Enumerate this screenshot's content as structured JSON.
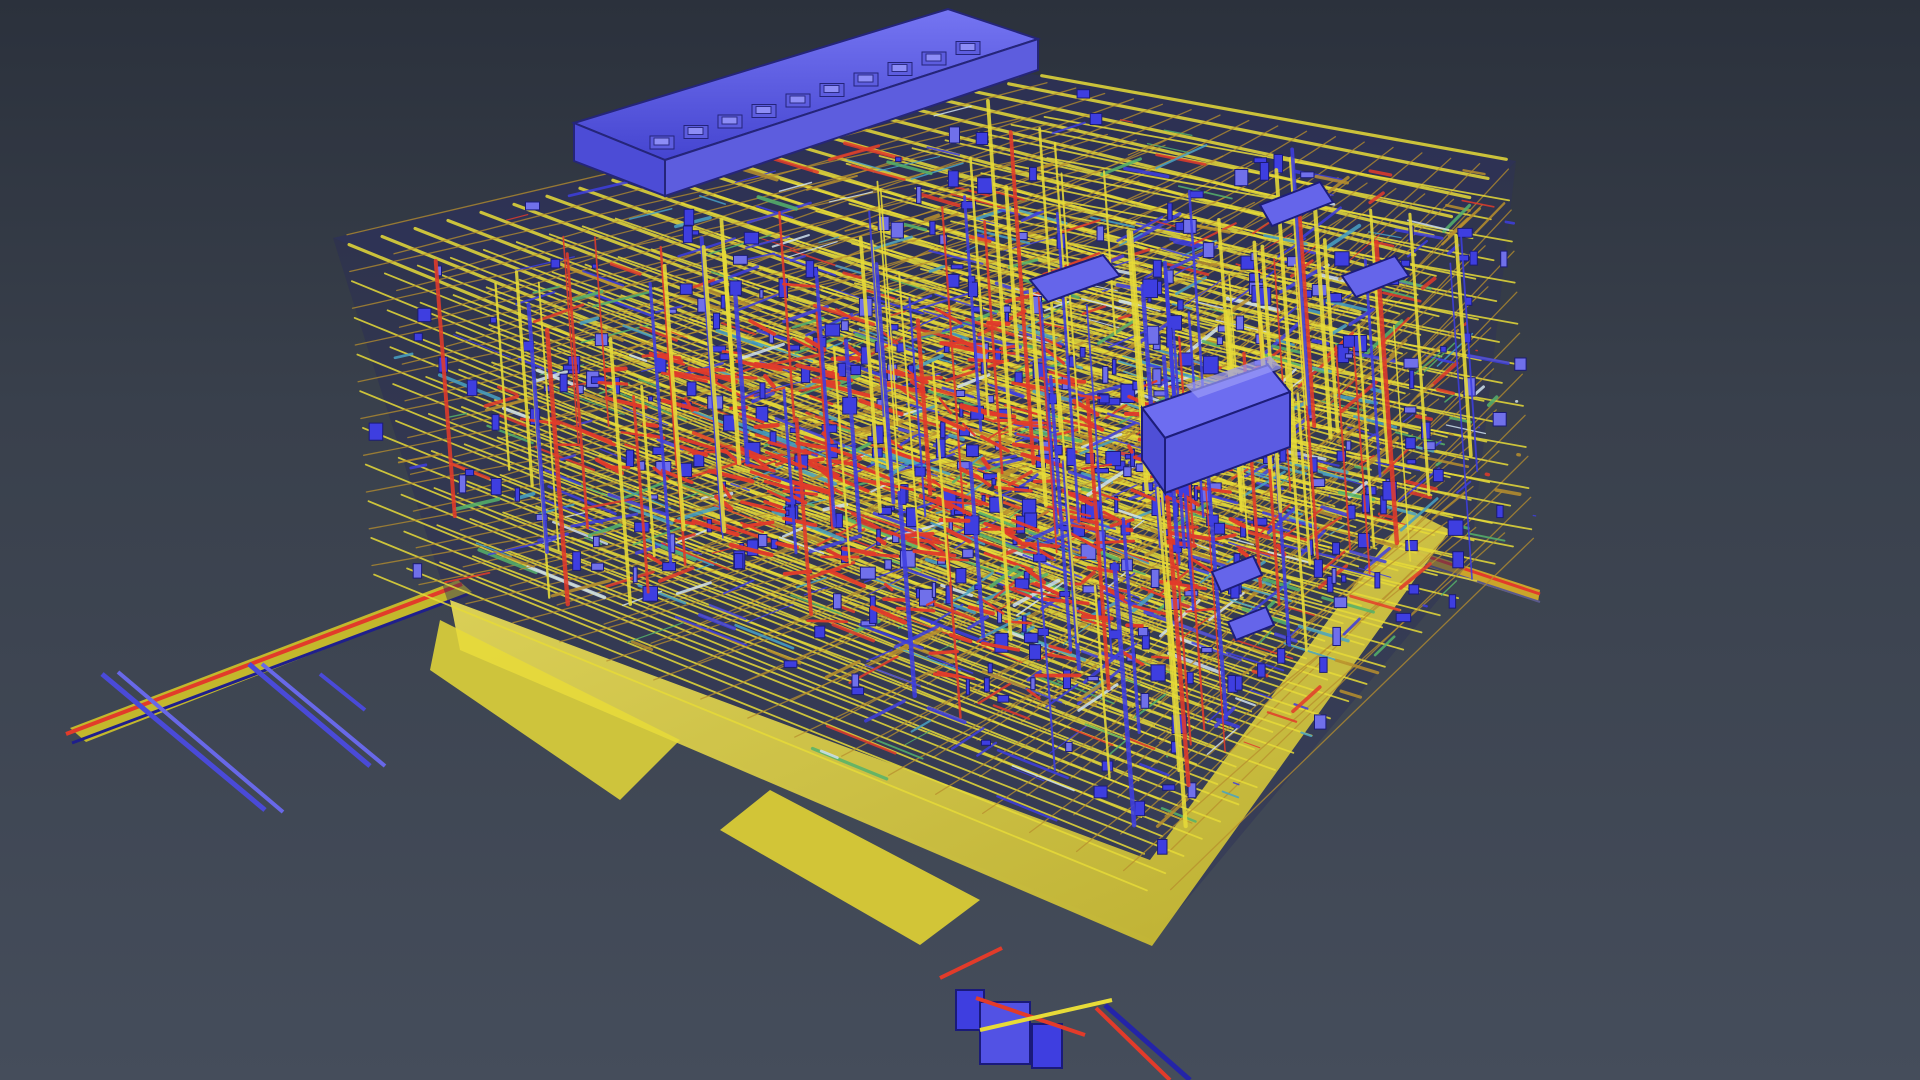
{
  "viewer": {
    "background_top": "#2b313c",
    "background_bottom": "#454d5b"
  },
  "model": {
    "layer_colors": {
      "structure": "#e7db38",
      "piping_hot": "#e23b2a",
      "equipment": "#3e3ee0",
      "equipment_light": "#7070ea",
      "piping_cool": "#48a2c4",
      "cable_tray": "#55b36b",
      "misc_pipe": "#b88f2d",
      "light_pipe": "#cfe1ee"
    }
  }
}
